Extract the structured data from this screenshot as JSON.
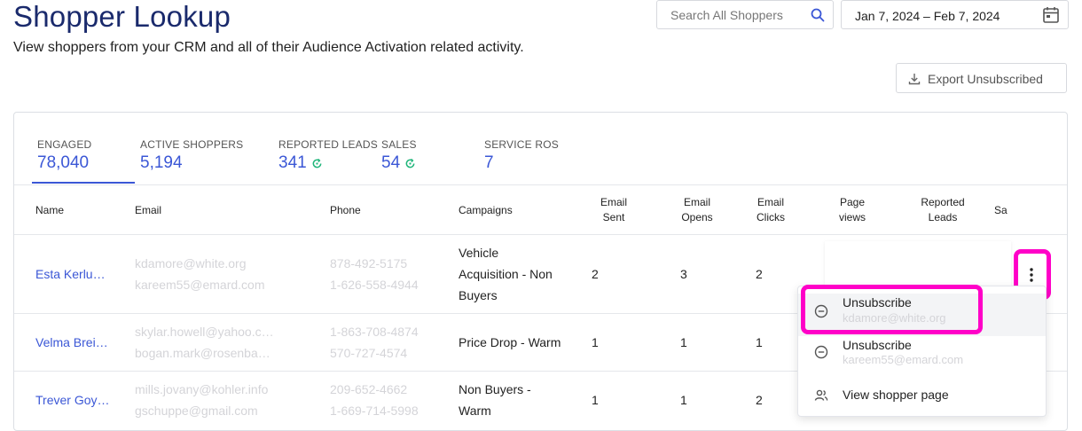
{
  "page": {
    "title": "Shopper Lookup",
    "subtitle": "View shoppers from your CRM and all of their Audience Activation related activity."
  },
  "search": {
    "placeholder": "Search All Shoppers",
    "icon": "search-icon"
  },
  "date_range": {
    "value": "Jan 7, 2024 – Feb 7, 2024",
    "icon": "calendar-icon"
  },
  "export": {
    "label": "Export Unsubscribed",
    "icon": "download-icon"
  },
  "stats": [
    {
      "label": "ENGAGED",
      "value": "78,040",
      "active": true
    },
    {
      "label": "ACTIVE SHOPPERS",
      "value": "5,194"
    },
    {
      "label": "REPORTED LEADS",
      "value": "341",
      "icon": "refresh-icon"
    },
    {
      "label": "SALES",
      "value": "54",
      "icon": "refresh-icon"
    },
    {
      "label": "SERVICE ROS",
      "value": "7"
    }
  ],
  "table": {
    "headers": {
      "name": "Name",
      "email": "Email",
      "phone": "Phone",
      "campaigns": "Campaigns",
      "email_sent": "Email Sent",
      "email_opens": "Email Opens",
      "email_clicks": "Email Clicks",
      "page_views": "Page views",
      "reported_leads": "Reported Leads",
      "sales": "Sa"
    },
    "rows": [
      {
        "name": "Esta Kerlu…",
        "email1": "kdamore@white.org",
        "email2": "kareem55@emard.com",
        "phone1": "878-492-5175",
        "phone2": "1-626-558-4944",
        "campaign1": "Vehicle",
        "campaign2": "Acquisition - Non",
        "campaign3": "Buyers",
        "sent": "2",
        "opens": "3",
        "clicks": "2"
      },
      {
        "name": "Velma Brei…",
        "email1": "skylar.howell@yahoo.c…",
        "email2": "bogan.mark@rosenba…",
        "phone1": "1-863-708-4874",
        "phone2": "570-727-4574",
        "campaign1": "Price Drop - Warm",
        "sent": "1",
        "opens": "1",
        "clicks": "1"
      },
      {
        "name": "Trever Goy…",
        "email1": "mills.jovany@kohler.info",
        "email2": "gschuppe@gmail.com",
        "phone1": "209-652-4662",
        "phone2": "1-669-714-5998",
        "campaign1": "Non Buyers -",
        "campaign2": "Warm",
        "sent": "1",
        "opens": "1",
        "clicks": "2"
      }
    ]
  },
  "menu": {
    "items": [
      {
        "title": "Unsubscribe",
        "subtitle": "kdamore@white.org",
        "icon": "minus-circle-icon"
      },
      {
        "title": "Unsubscribe",
        "subtitle": "kareem55@emard.com",
        "icon": "minus-circle-icon"
      },
      {
        "title": "View shopper page",
        "icon": "people-icon"
      }
    ]
  },
  "colors": {
    "accent": "#3b57d6",
    "highlight": "#ff00c8",
    "title": "#1a2a6c",
    "green": "#1fb57a"
  }
}
